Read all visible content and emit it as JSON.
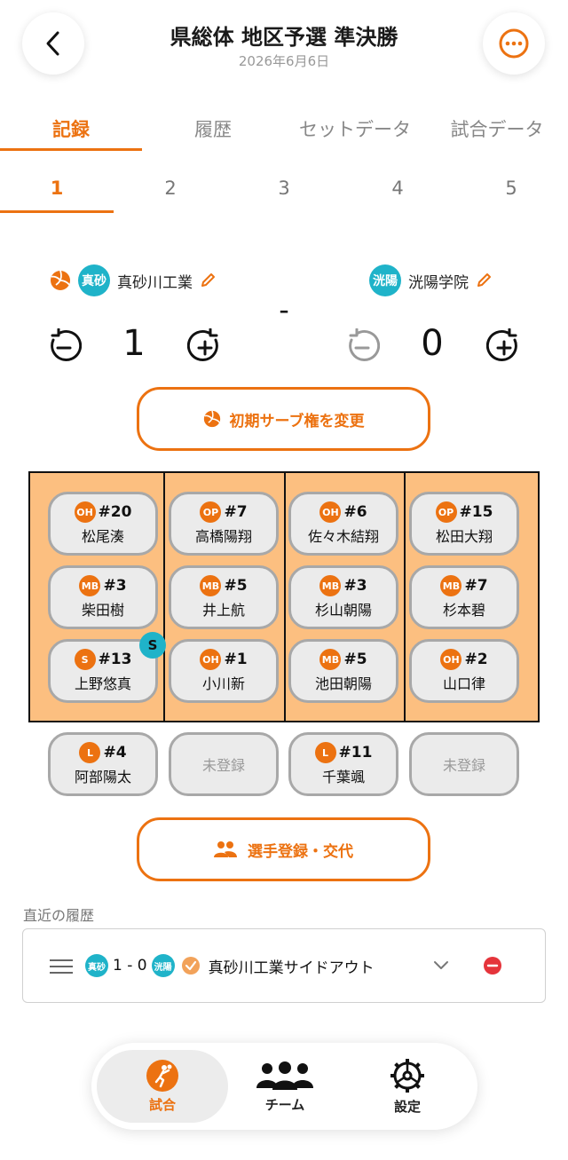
{
  "header": {
    "title": "県総体 地区予選 準決勝",
    "date": "2026年6月6日"
  },
  "tabs": [
    {
      "label": "記録",
      "active": true
    },
    {
      "label": "履歴",
      "active": false
    },
    {
      "label": "セットデータ",
      "active": false
    },
    {
      "label": "試合データ",
      "active": false
    }
  ],
  "sets": [
    {
      "label": "1",
      "active": true
    },
    {
      "label": "2",
      "active": false
    },
    {
      "label": "3",
      "active": false
    },
    {
      "label": "4",
      "active": false
    },
    {
      "label": "5",
      "active": false
    }
  ],
  "scoreboard": {
    "separator": "-",
    "home": {
      "badge": "真砂",
      "name": "真砂川工業",
      "score": "1",
      "serving": true
    },
    "away": {
      "badge": "洸陽",
      "name": "洸陽学院",
      "score": "0",
      "serving": false
    }
  },
  "serve_button_label": "初期サーブ権を変更",
  "court": {
    "rows": [
      [
        {
          "pos": "OH",
          "num": "#20",
          "name": "松尾湊"
        },
        {
          "pos": "OP",
          "num": "#7",
          "name": "高橋陽翔"
        },
        {
          "pos": "OH",
          "num": "#6",
          "name": "佐々木結翔"
        },
        {
          "pos": "OP",
          "num": "#15",
          "name": "松田大翔"
        }
      ],
      [
        {
          "pos": "MB",
          "num": "#3",
          "name": "柴田樹"
        },
        {
          "pos": "MB",
          "num": "#5",
          "name": "井上航"
        },
        {
          "pos": "MB",
          "num": "#3",
          "name": "杉山朝陽"
        },
        {
          "pos": "MB",
          "num": "#7",
          "name": "杉本碧"
        }
      ],
      [
        {
          "pos": "S",
          "num": "#13",
          "name": "上野悠真"
        },
        {
          "pos": "OH",
          "num": "#1",
          "name": "小川新"
        },
        {
          "pos": "MB",
          "num": "#5",
          "name": "池田朝陽"
        },
        {
          "pos": "OH",
          "num": "#2",
          "name": "山口律"
        }
      ]
    ],
    "server_marker": "S"
  },
  "liberos": [
    {
      "pos": "L",
      "num": "#4",
      "name": "阿部陽太"
    },
    {
      "unregistered": "未登録"
    },
    {
      "pos": "L",
      "num": "#11",
      "name": "千葉颯"
    },
    {
      "unregistered": "未登録"
    }
  ],
  "substitute_button_label": "選手登録・交代",
  "history": {
    "section_label": "直近の履歴",
    "entry": {
      "home_badge": "真砂",
      "score": "1 - 0",
      "away_badge": "洸陽",
      "text": "真砂川工業サイドアウト"
    }
  },
  "bottom_nav": [
    {
      "label": "試合",
      "icon": "volleyball-player-icon",
      "active": true
    },
    {
      "label": "チーム",
      "icon": "team-icon",
      "active": false
    },
    {
      "label": "設定",
      "icon": "gear-icon",
      "active": false
    }
  ],
  "colors": {
    "accent": "#ec7211",
    "team_badge": "#1fb3c9",
    "court": "#fcbf80",
    "delete": "#e5343b"
  }
}
